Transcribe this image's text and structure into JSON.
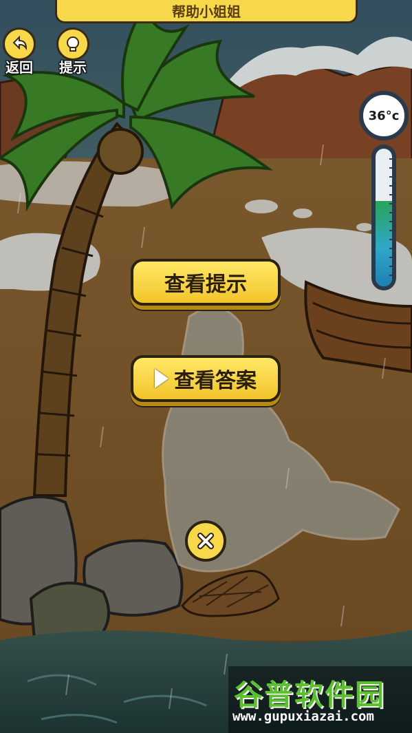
{
  "header": {
    "title": "帮助小姐姐"
  },
  "buttons": {
    "back_label": "返回",
    "hint_label": "提示",
    "view_hint_label": "查看提示",
    "view_answer_label": "查看答案"
  },
  "thermometer": {
    "temperature_text": "36°c",
    "level_fraction": 0.62
  },
  "watermark": {
    "brand": "谷普软件园",
    "url": "www.gupuxiazai.com"
  },
  "icons": [
    "back-arrow-icon",
    "lightbulb-icon",
    "play-icon",
    "close-icon"
  ],
  "colors": {
    "button_yellow": "#f6d84a",
    "outline": "#2b2210",
    "mercury_green": "#2aa35a",
    "mercury_blue": "#2fa8c8"
  }
}
